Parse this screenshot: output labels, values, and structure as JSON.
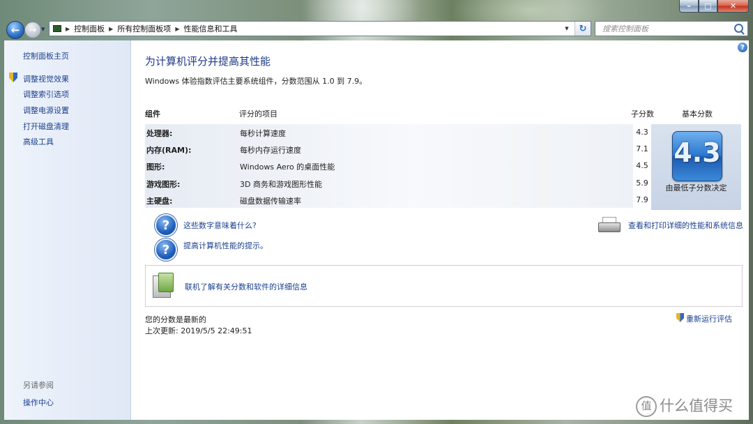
{
  "window": {
    "title_buttons": {
      "minimize": "–",
      "maximize": "□",
      "close": "✕"
    }
  },
  "nav": {
    "breadcrumbs": [
      "控制面板",
      "所有控制面板项",
      "性能信息和工具"
    ],
    "search_placeholder": "搜索控制面板",
    "back_icon": "back-arrow-icon",
    "refresh_glyph": "↻"
  },
  "sidebar": {
    "home": "控制面板主页",
    "items": [
      {
        "label": "调整视觉效果",
        "shield": true
      },
      {
        "label": "调整索引选项",
        "shield": false
      },
      {
        "label": "调整电源设置",
        "shield": false
      },
      {
        "label": "打开磁盘清理",
        "shield": false
      },
      {
        "label": "高级工具",
        "shield": false
      }
    ],
    "see_also_title": "另请参阅",
    "see_also_items": [
      "操作中心"
    ]
  },
  "main": {
    "title": "为计算机评分并提高其性能",
    "description": "Windows 体验指数评估主要系统组件，分数范围从 1.0 到 7.9。",
    "table": {
      "headers": {
        "component": "组件",
        "item": "评分的项目",
        "subscore": "子分数",
        "base": "基本分数"
      },
      "rows": [
        {
          "component": "处理器:",
          "item": "每秒计算速度",
          "subscore": "4.3"
        },
        {
          "component": "内存(RAM):",
          "item": "每秒内存运行速度",
          "subscore": "7.1"
        },
        {
          "component": "图形:",
          "item": "Windows Aero 的桌面性能",
          "subscore": "4.5"
        },
        {
          "component": "游戏图形:",
          "item": "3D 商务和游戏图形性能",
          "subscore": "5.9"
        },
        {
          "component": "主硬盘:",
          "item": "磁盘数据传输速率",
          "subscore": "7.9"
        }
      ],
      "base_score": "4.3",
      "base_caption": "由最低子分数决定"
    },
    "links": {
      "what_mean": "这些数字意味着什么?",
      "tips": "提高计算机性能的提示。",
      "print_details": "查看和打印详细的性能和系统信息",
      "online_info": "联机了解有关分数和软件的详细信息"
    },
    "status": {
      "current": "您的分数是最新的",
      "last_update": "上次更新: 2019/5/5 22:49:51",
      "rerun": "重新运行评估"
    }
  },
  "watermark": {
    "logo": "值",
    "text": "什么值得买"
  },
  "colors": {
    "link": "#1a3f8f",
    "title": "#1e3a8a"
  }
}
